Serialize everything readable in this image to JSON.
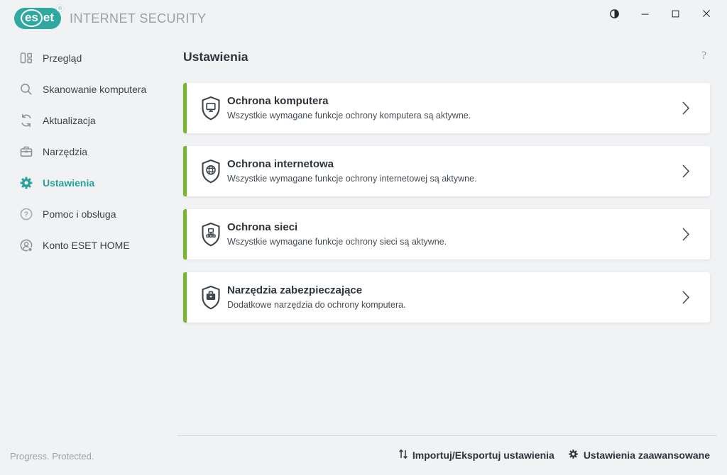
{
  "colors": {
    "accent_teal": "#2FA8A0",
    "active_item_teal": "#27A099",
    "eset_green": "#77B72C",
    "background": "#F1F2F4"
  },
  "header": {
    "logo_es": "es",
    "logo_et": "et",
    "logo_reg": "®",
    "product_name": "INTERNET SECURITY",
    "window_controls": [
      "contrast-toggle",
      "minimize",
      "maximize",
      "close"
    ]
  },
  "sidebar": {
    "items": [
      {
        "label": "Przegląd",
        "icon": "overview-icon",
        "active": false
      },
      {
        "label": "Skanowanie komputera",
        "icon": "computer-scan-icon",
        "active": false
      },
      {
        "label": "Aktualizacja",
        "icon": "update-refresh-icon",
        "active": false
      },
      {
        "label": "Narzędzia",
        "icon": "tools-briefcase-icon",
        "active": false
      },
      {
        "label": "Ustawienia",
        "icon": "settings-gear-icon",
        "active": true
      },
      {
        "label": "Pomoc i obsługa",
        "icon": "help-question-icon",
        "active": false
      },
      {
        "label": "Konto ESET HOME",
        "icon": "account-icon",
        "active": false
      }
    ]
  },
  "main": {
    "title": "Ustawienia",
    "help_label": "?",
    "cards": [
      {
        "title": "Ochrona komputera",
        "subtitle": "Wszystkie wymagane funkcje ochrony komputera są aktywne.",
        "icon": "shield-computer-icon"
      },
      {
        "title": "Ochrona internetowa",
        "subtitle": "Wszystkie wymagane funkcje ochrony internetowej są aktywne.",
        "icon": "shield-globe-icon"
      },
      {
        "title": "Ochrona sieci",
        "subtitle": "Wszystkie wymagane funkcje ochrony sieci są aktywne.",
        "icon": "shield-network-icon"
      },
      {
        "title": "Narzędzia zabezpieczające",
        "subtitle": "Dodatkowe narzędzia do ochrony komputera.",
        "icon": "shield-briefcase-icon"
      }
    ]
  },
  "footer": {
    "status": "Progress. Protected.",
    "actions": [
      {
        "label": "Importuj/Eksportuj ustawienia",
        "icon": "import-export-icon"
      },
      {
        "label": "Ustawienia zaawansowane",
        "icon": "gear-icon"
      }
    ]
  }
}
